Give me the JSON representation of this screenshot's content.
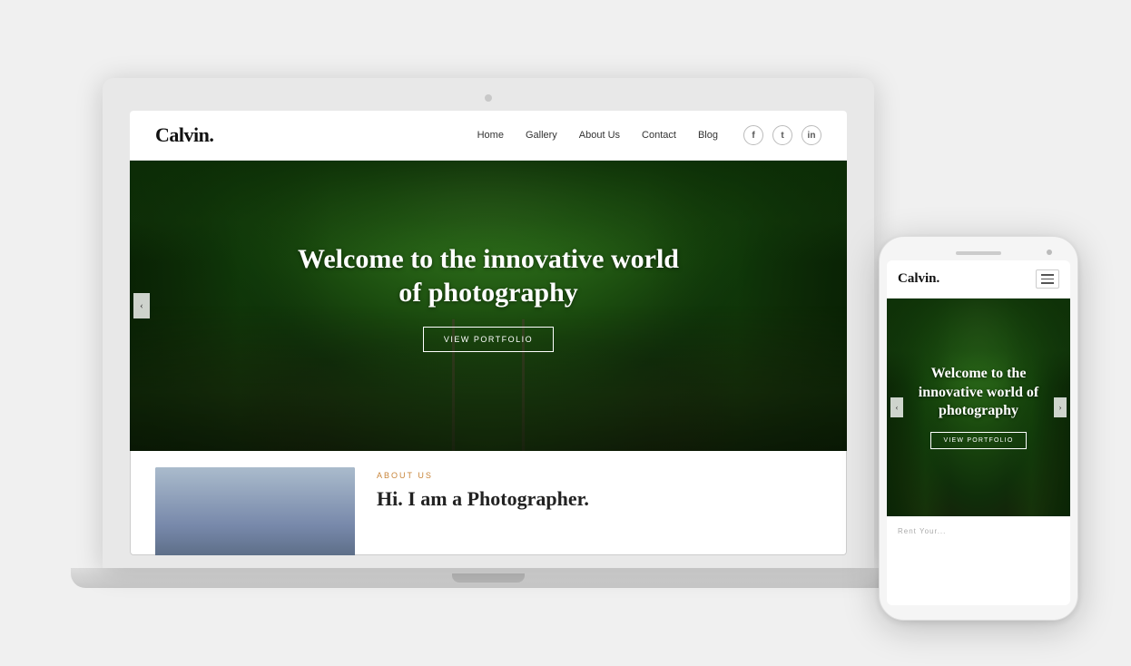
{
  "laptop": {
    "site": {
      "logo": "Calvin.",
      "nav": {
        "links": [
          "Home",
          "Gallery",
          "About Us",
          "Contact",
          "Blog"
        ]
      },
      "social": [
        "f",
        "t",
        "in"
      ],
      "hero": {
        "title": "Welcome to the innovative world of photography",
        "btn_label": "VIEW PORTFOLIO",
        "arrow_label": "‹"
      },
      "about": {
        "section_label": "ABOUT US",
        "heading": "Hi. I am a Photographer."
      }
    }
  },
  "phone": {
    "site": {
      "logo": "Calvin.",
      "hero": {
        "title": "Welcome to the innovative world of photography",
        "btn_label": "VIEW PORTFOLIO",
        "arrow_left": "‹",
        "arrow_right": "›"
      },
      "below_label": "Rent Your..."
    }
  },
  "colors": {
    "accent": "#c8853a",
    "logo_color": "#111111",
    "hero_text": "#ffffff",
    "nav_link": "#333333"
  }
}
